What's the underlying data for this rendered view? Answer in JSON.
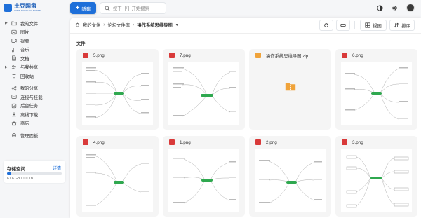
{
  "app": {
    "logo_title": "土豆网盘",
    "logo_sub": "WWW.TUDOUWANGPAN"
  },
  "colors": {
    "accent": "#1e6fd9",
    "image_icon": "#d93a3a",
    "zip_icon": "#f0a33a",
    "mindmap_green": "#2fa84f"
  },
  "header": {
    "new_label": "新建",
    "search_placeholder": "按下 / 开始搜索",
    "search_key": "/",
    "search_hint": "开始搜索",
    "search_prefix": "按下"
  },
  "sidebar": {
    "items": [
      {
        "label": "我的文件",
        "icon": "folder-icon",
        "expandable": true
      },
      {
        "label": "图片",
        "icon": "image-icon"
      },
      {
        "label": "视频",
        "icon": "video-icon"
      },
      {
        "label": "音乐",
        "icon": "music-icon"
      },
      {
        "label": "文档",
        "icon": "document-icon"
      },
      {
        "label": "与我共享",
        "icon": "share-people-icon",
        "expandable": true
      },
      {
        "label": "回收站",
        "icon": "trash-icon"
      },
      {
        "label": "我的分享",
        "icon": "share-icon"
      },
      {
        "label": "连接与挂载",
        "icon": "link-icon"
      },
      {
        "label": "后台任务",
        "icon": "task-icon"
      },
      {
        "label": "离线下载",
        "icon": "download-icon"
      },
      {
        "label": "商店",
        "icon": "store-icon"
      },
      {
        "label": "管理面板",
        "icon": "admin-icon"
      }
    ],
    "storage": {
      "title": "存储空间",
      "link": "详情",
      "used_text": "61.6 GB / 1.0 TB",
      "used_fraction": 0.06
    }
  },
  "toolbar": {
    "breadcrumb": [
      "我的文件",
      "论坛文件库",
      "操作系统思维导图"
    ],
    "view_label": "视图",
    "sort_label": "排序"
  },
  "main": {
    "section_title": "文件",
    "files": [
      {
        "name": "5.png",
        "type": "image"
      },
      {
        "name": "7.png",
        "type": "image"
      },
      {
        "name": "操作系统思维导图.zip",
        "type": "zip"
      },
      {
        "name": "6.png",
        "type": "image"
      },
      {
        "name": "4.png",
        "type": "image"
      },
      {
        "name": "1.png",
        "type": "image"
      },
      {
        "name": "2.png",
        "type": "image"
      },
      {
        "name": "3.png",
        "type": "image"
      }
    ]
  }
}
